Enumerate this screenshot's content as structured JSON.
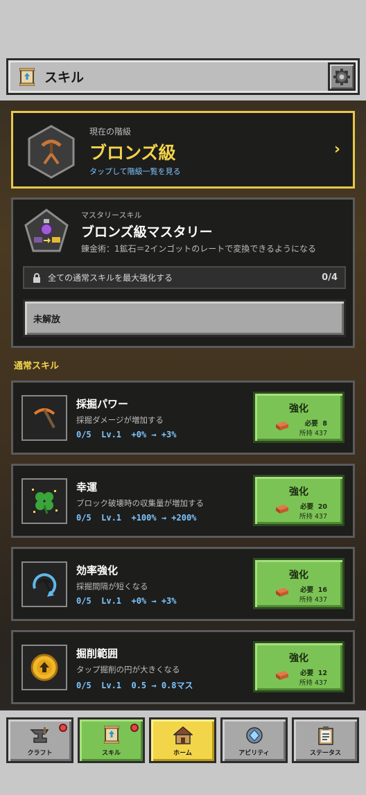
{
  "header": {
    "title": "スキル"
  },
  "rank": {
    "label": "現在の階級",
    "name": "ブロンズ級",
    "link": "タップして階級一覧を見る"
  },
  "mastery": {
    "label": "マスタリースキル",
    "title": "ブロンズ級マスタリー",
    "desc": "錬金術：1鉱石＝2インゴットのレートで変換できるようになる",
    "condition": "全ての通常スキルを最大強化する",
    "progress": "0/4",
    "status_button": "未解放"
  },
  "section_title": "通常スキル",
  "skills": [
    {
      "name": "採掘パワー",
      "desc": "採掘ダメージが増加する",
      "stats": "0/5  Lv.1  +0% → +3%",
      "upgrade": "強化",
      "need": "必要  8",
      "have": "所持 437",
      "icon": "pickaxe-icon"
    },
    {
      "name": "幸運",
      "desc": "ブロック破壊時の収集量が増加する",
      "stats": "0/5  Lv.1  +100% → +200%",
      "upgrade": "強化",
      "need": "必要  20",
      "have": "所持 437",
      "icon": "clover-icon"
    },
    {
      "name": "効率強化",
      "desc": "採掘間隔が短くなる",
      "stats": "0/5  Lv.1  +0% → +3%",
      "upgrade": "強化",
      "need": "必要  16",
      "have": "所持 437",
      "icon": "efficiency-icon"
    },
    {
      "name": "掘削範囲",
      "desc": "タップ掘削の円が大きくなる",
      "stats": "0/5  Lv.1  0.5 → 0.8マス",
      "upgrade": "強化",
      "need": "必要  12",
      "have": "所持 437",
      "icon": "range-icon"
    }
  ],
  "nav": [
    {
      "label": "クラフト",
      "icon": "anvil-icon",
      "badge": true
    },
    {
      "label": "スキル",
      "icon": "scroll-icon",
      "badge": true
    },
    {
      "label": "ホーム",
      "icon": "house-icon",
      "badge": false
    },
    {
      "label": "アビリティ",
      "icon": "gem-icon",
      "badge": false
    },
    {
      "label": "ステータス",
      "icon": "clipboard-icon",
      "badge": false
    }
  ],
  "colors": {
    "accent_yellow": "#f3d54a",
    "button_green": "#7cc356",
    "link_blue": "#7fc6ff"
  }
}
